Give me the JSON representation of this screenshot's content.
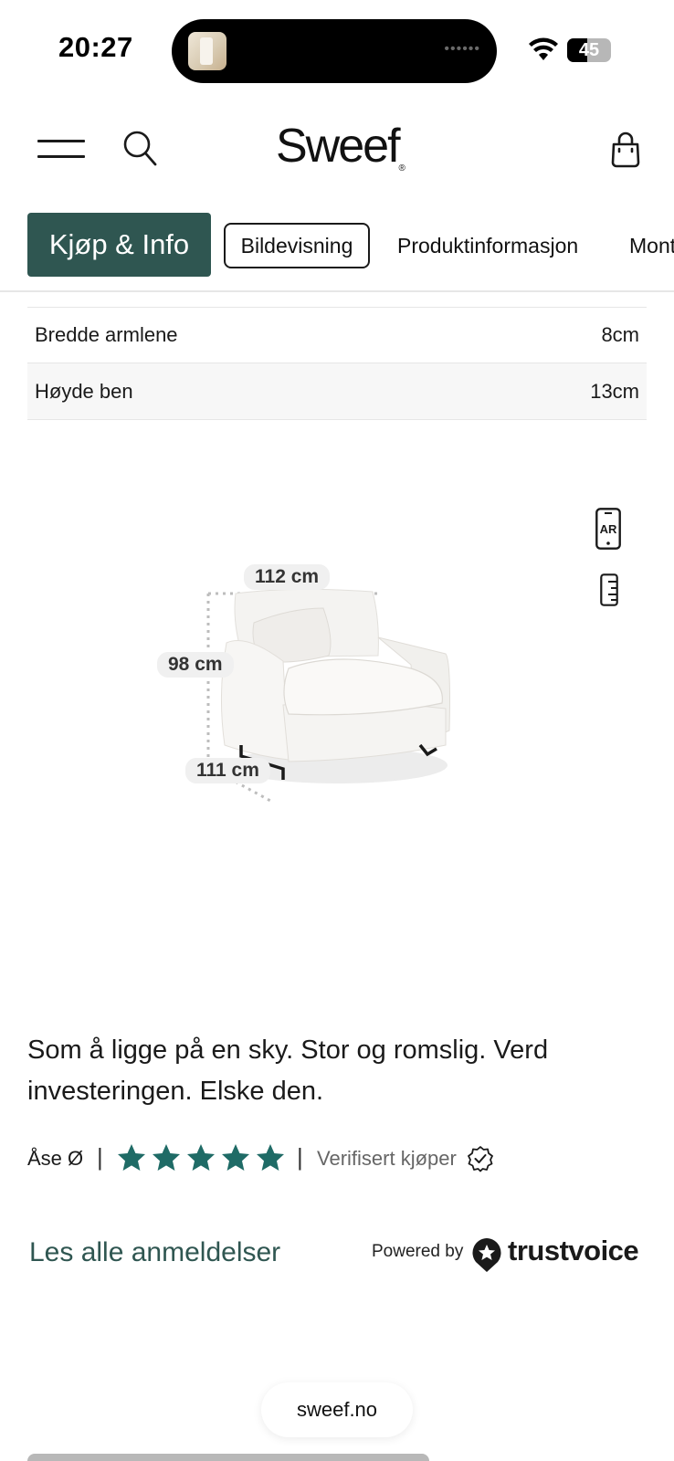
{
  "status_bar": {
    "time": "20:27",
    "battery_level": "45",
    "battery_fraction": 0.45
  },
  "header": {
    "logo": "Sweef",
    "logo_mark": "®"
  },
  "tabs": [
    {
      "label": "Kjøp & Info"
    },
    {
      "label": "Bildevisning"
    },
    {
      "label": "Produktinformasjon"
    },
    {
      "label": "Mont"
    }
  ],
  "specs": [
    {
      "label": "Bredde armlene",
      "value": "8cm"
    },
    {
      "label": "Høyde ben",
      "value": "13cm"
    }
  ],
  "product_view": {
    "ar_label": "AR",
    "dimensions": {
      "width": "112 cm",
      "height": "98 cm",
      "depth": "111 cm"
    }
  },
  "review": {
    "text": "Som å ligge på en sky. Stor og romslig. Verd investeringen. Elske den.",
    "reviewer": "Åse Ø",
    "rating": 5,
    "rating_max": 5,
    "verified_label": "Verifisert kjøper",
    "star_color": "#1f6b66"
  },
  "reviews_link": "Les alle anmeldelser",
  "powered_by": {
    "label": "Powered by",
    "brand": "trustvoice"
  },
  "browser": {
    "url": "sweef.no"
  },
  "colors": {
    "accent": "#2f5651",
    "star": "#1f6b66"
  }
}
